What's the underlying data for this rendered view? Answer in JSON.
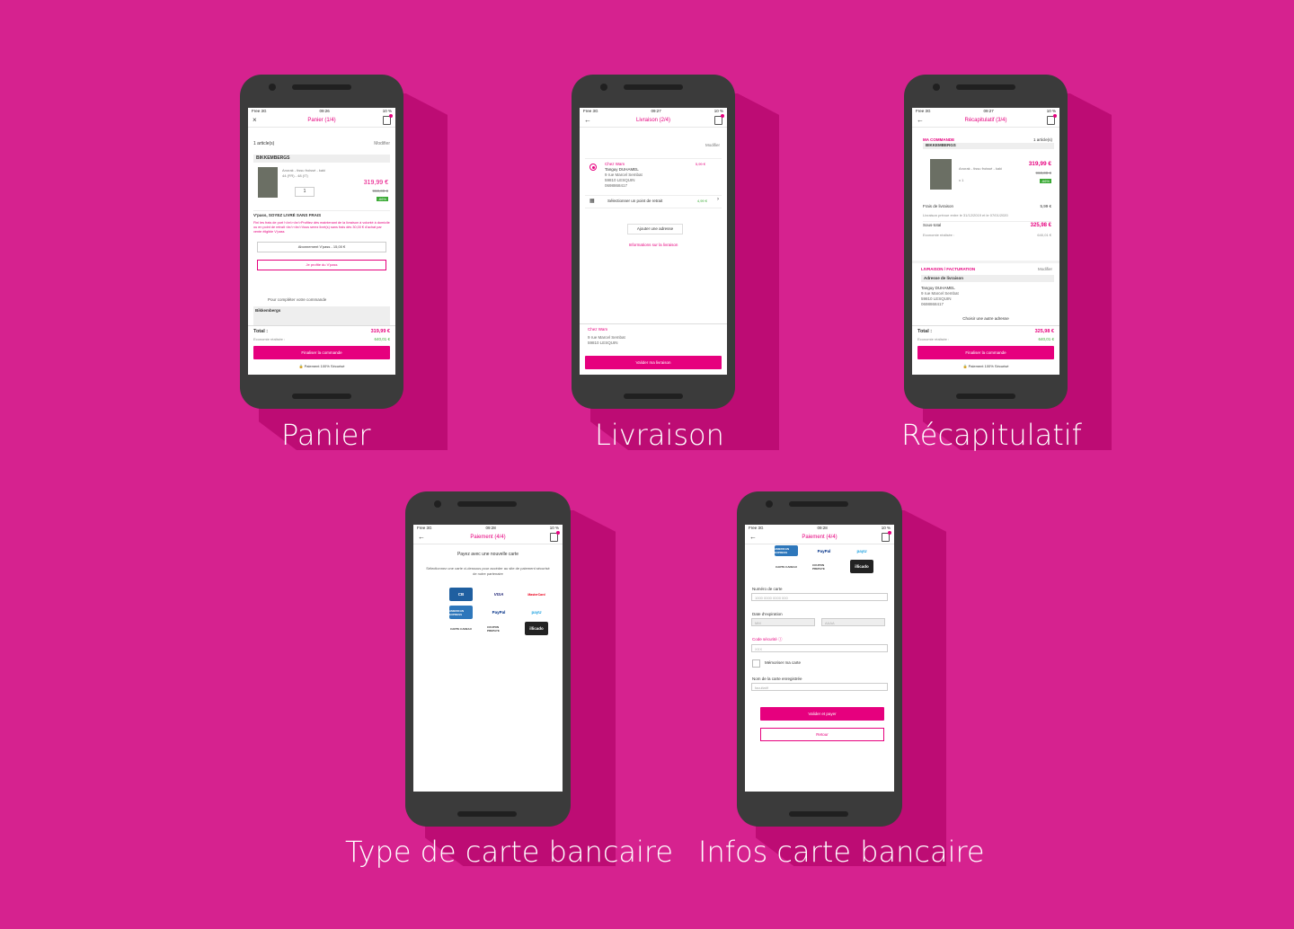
{
  "labels": [
    "Panier",
    "Livraison",
    "Récapitulatif",
    "Type de carte bancaire",
    "Infos carte bancaire"
  ],
  "colors": {
    "background": "#d6228f",
    "shadow": "#bd0c74",
    "accent": "#e6007e",
    "green": "#3aaa35"
  },
  "panier": {
    "status": {
      "carrier": "Free 3G",
      "time": "09:26",
      "battery": "10 %"
    },
    "title": "Panier (1/4)",
    "count": "1 article(s)",
    "modify": "Modifier",
    "brand": "BIKKEMBERGS",
    "desc": "Anorak - tissu froissé - kaki",
    "size": "44 (FR) - 48 (IT)",
    "qty": "1",
    "price": "319,99 €",
    "old_price": "960,00 €",
    "discount": "-66%",
    "vpass_title": "V'pass, SOYEZ LIVRÉ SANS FRAIS",
    "vpass_text": "Fini les frais de port !<br/><br/>Profitez dès maintenant de la livraison à volonté à domicile ou en point de retrait <br/><br/>Vous serez livré(s) sans frais dès 30,00 € d'achat par vente éligible V'pass",
    "vpass_select": "Abonnement V'pass - 15,00 €",
    "vpass_btn": "Je profite du V'pass",
    "complete": "Pour compléter votre commande",
    "complete_brand": "Bikkembergs",
    "total_label": "Total :",
    "total": "319,99 €",
    "savings_label": "Economie réalisée :",
    "savings": "640,01 €",
    "cta": "Finaliser la commande",
    "secure": "Paiement 100% Sécurisé"
  },
  "livraison": {
    "status": {
      "carrier": "Free 3G",
      "time": "09:27",
      "battery": "10 %"
    },
    "title": "Livraison (2/4)",
    "modify": "Modifier",
    "opt1_name": "Chez Wam",
    "opt1_person": "Tanguy DUHAMEL",
    "opt1_street": "9 rue Marcel Sembat",
    "opt1_city": "59810 LESQUIN",
    "opt1_phone": "0698868417",
    "opt1_price": "5,99 €",
    "opt2_label": "Sélectionner un point de retrait",
    "opt2_price": "4,99 €",
    "add_address": "Ajouter une adresse",
    "info_link": "Informations sur la livraison",
    "sum_name": "Chez Wam",
    "sum_street": "9 rue Marcel Sembat",
    "sum_city": "59810 LESQUIN",
    "cta": "Valider ma livraison"
  },
  "recap": {
    "status": {
      "carrier": "Free 3G",
      "time": "09:27",
      "battery": "10 %"
    },
    "title": "Récapitulatif (3/4)",
    "order_label": "MA COMMANDE",
    "count": "1 article(s)",
    "brand": "BIKKEMBERGS",
    "desc": "Anorak - tissu froissé - kaki",
    "qty": "x 1",
    "price": "319,99 €",
    "old_price": "960,00 €",
    "discount": "-66%",
    "shipping_label": "Frais de livraison",
    "shipping": "5,99 €",
    "delivery_date": "Livraison prévue entre le 31/12/2019 et le 07/01/2020",
    "subtotal_label": "Sous-total",
    "subtotal": "325,98 €",
    "savings_label": "Economie réalisée :",
    "savings": "640,01 €",
    "billing_label": "LIVRAISON / FACTURATION",
    "modify": "Modifier",
    "addr_title": "Adresse de livraison",
    "addr_person": "Tanguy DUHAMEL",
    "addr_street": "9 rue Marcel Sembat",
    "addr_city": "59810 LESQUIN",
    "addr_phone": "0698868417",
    "choose_other": "Choisir une autre adresse",
    "total_label": "Total :",
    "total": "325,98 €",
    "savings2_label": "Economie réalisée :",
    "savings2": "640,01 €",
    "cta": "Finaliser la commande",
    "secure": "Paiement 100% Sécurisé"
  },
  "type_carte": {
    "status": {
      "carrier": "Free 3G",
      "time": "09:28",
      "battery": "10 %"
    },
    "title": "Paiement (4/4)",
    "heading": "Payez avec une nouvelle carte",
    "instructions": "Sélectionnez une carte ci-dessous pour accéder au site de paiement sécurisé de notre partenaire",
    "cards": [
      "CB",
      "VISA",
      "MasterCard",
      "AMERICAN EXPRESS",
      "PayPal",
      "payU",
      "CARTE CADEAU",
      "COUPON PREPAYE",
      "illicado"
    ]
  },
  "infos_carte": {
    "status": {
      "carrier": "Free 3G",
      "time": "09:28",
      "battery": "10 %"
    },
    "title": "Paiement (4/4)",
    "cards": [
      "AMERICAN EXPRESS",
      "PayPal",
      "payU",
      "CARTE CADEAU",
      "COUPON PREPAYE",
      "illicado"
    ],
    "card_number_label": "Numéro de carte",
    "card_number_placeholder": "1000 0000 0000 000",
    "expiry_label": "Date d'expiration",
    "month_placeholder": "MM",
    "year_placeholder": "AAAA",
    "cvv_label": "Code sécurité",
    "cvv_placeholder": "XXX",
    "remember_label": "Mémoriser ma carte",
    "card_name_label": "Nom de la carte enregistrée",
    "card_name_placeholder": "facultatif",
    "pay_btn": "Valider et payer",
    "back_btn": "Retour"
  }
}
